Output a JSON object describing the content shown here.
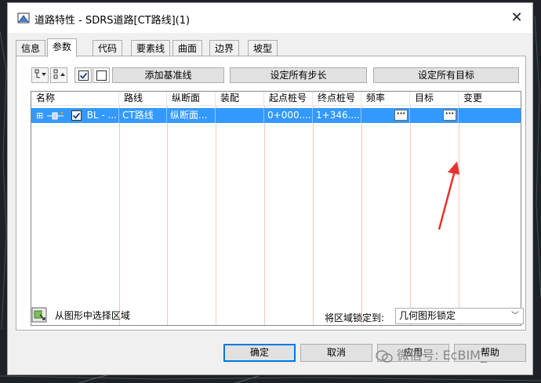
{
  "window": {
    "title": "道路特性 - SDRS道路[CT路线](1)",
    "close_glyph": "✕"
  },
  "tabs": [
    {
      "label": "信息"
    },
    {
      "label": "参数"
    },
    {
      "label": "代码"
    },
    {
      "label": "要素线"
    },
    {
      "label": "曲面"
    },
    {
      "label": "边界"
    },
    {
      "label": "坡型"
    }
  ],
  "toolbar": {
    "add_baseline": "添加基准线",
    "set_all_steps": "设定所有步长",
    "set_all_targets": "设定所有目标"
  },
  "grid": {
    "columns": [
      "名称",
      "路线",
      "纵断面",
      "装配",
      "起点桩号",
      "终点桩号",
      "频率",
      "目标",
      "变更"
    ],
    "rows": [
      {
        "expander": "⊞",
        "name": "BL - ...",
        "alignment": "CT路线",
        "profile": "纵断面...",
        "assembly": "",
        "start_station": "0+000....",
        "end_station": "1+346....",
        "frequency_btn": "···",
        "target_btn": "···",
        "override": ""
      }
    ]
  },
  "footer": {
    "select_region": "从图形中选择区域",
    "lock_label": "将区域锁定到:",
    "lock_value": "几何图形锁定"
  },
  "buttons": {
    "ok": "确定",
    "cancel": "取消",
    "apply": "应用",
    "help": "帮助"
  },
  "watermark": "微信号: EcBIM_",
  "colors": {
    "selection": "#3399ff",
    "annotation_arrow": "#e8312c"
  }
}
